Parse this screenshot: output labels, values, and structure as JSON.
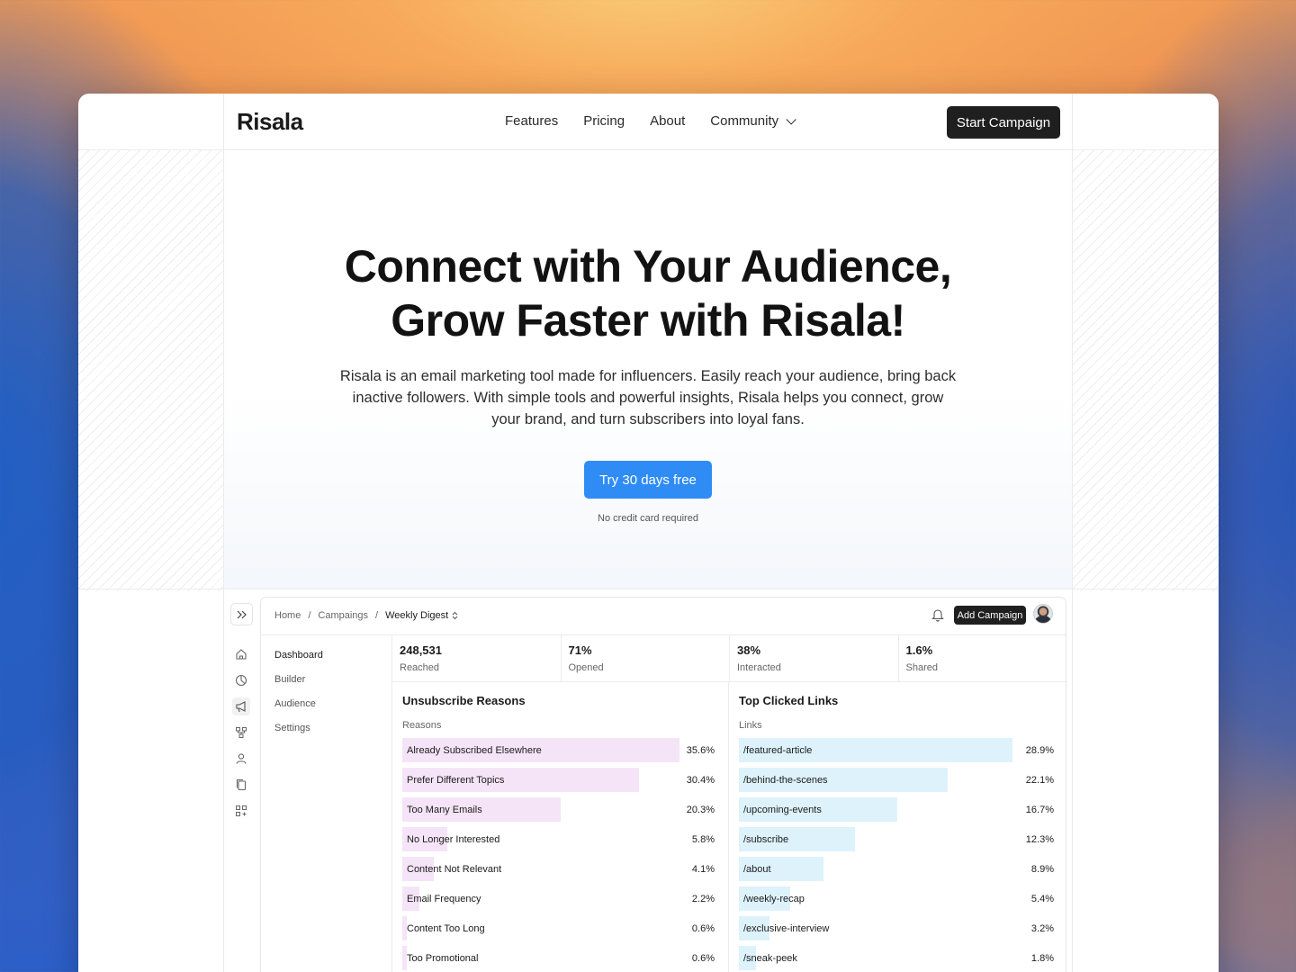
{
  "brand": "Risala",
  "nav": {
    "items": [
      "Features",
      "Pricing",
      "About",
      "Community"
    ],
    "cta": "Start Campaign"
  },
  "hero": {
    "title_line1": "Connect with Your Audience,",
    "title_line2": "Grow Faster with Risala!",
    "subtitle": "Risala is an email marketing tool made for influencers. Easily reach your audience, bring back inactive followers. With simple tools and powerful insights, Risala helps you connect, grow your brand, and turn subscribers into loyal fans.",
    "cta": "Try 30 days free",
    "note": "No credit card required"
  },
  "dashboard": {
    "breadcrumb": [
      "Home",
      "Campaings",
      "Weekly Digest"
    ],
    "add_button": "Add Campaign",
    "sidebar": [
      "Dashboard",
      "Builder",
      "Audience",
      "Settings"
    ],
    "rail_icons": [
      "home-icon",
      "pie-chart-icon",
      "megaphone-icon",
      "workflow-icon",
      "user-icon",
      "copy-icon",
      "apps-icon"
    ],
    "stats": [
      {
        "value": "248,531",
        "label": "Reached"
      },
      {
        "value": "71%",
        "label": "Opened"
      },
      {
        "value": "38%",
        "label": "Interacted"
      },
      {
        "value": "1.6%",
        "label": "Shared"
      }
    ],
    "unsubscribe": {
      "title": "Unsubscribe Reasons",
      "subtitle": "Reasons",
      "color": "#f5e4f7",
      "rows": [
        {
          "label": "Already Subscribed Elsewhere",
          "pct": "35.6%",
          "value": 35.6
        },
        {
          "label": "Prefer Different Topics",
          "pct": "30.4%",
          "value": 30.4
        },
        {
          "label": "Too Many Emails",
          "pct": "20.3%",
          "value": 20.3
        },
        {
          "label": "No Longer Interested",
          "pct": "5.8%",
          "value": 5.8
        },
        {
          "label": "Content Not Relevant",
          "pct": "4.1%",
          "value": 4.1
        },
        {
          "label": "Email Frequency",
          "pct": "2.2%",
          "value": 2.2
        },
        {
          "label": "Content Too Long",
          "pct": "0.6%",
          "value": 0.6
        },
        {
          "label": "Too Promotional",
          "pct": "0.6%",
          "value": 0.6
        }
      ]
    },
    "links": {
      "title": "Top Clicked Links",
      "subtitle": "Links",
      "color": "#ddf2fb",
      "rows": [
        {
          "label": "/featured-article",
          "pct": "28.9%",
          "value": 28.9
        },
        {
          "label": "/behind-the-scenes",
          "pct": "22.1%",
          "value": 22.1
        },
        {
          "label": "/upcoming-events",
          "pct": "16.7%",
          "value": 16.7
        },
        {
          "label": "/subscribe",
          "pct": "12.3%",
          "value": 12.3
        },
        {
          "label": "/about",
          "pct": "8.9%",
          "value": 8.9
        },
        {
          "label": "/weekly-recap",
          "pct": "5.4%",
          "value": 5.4
        },
        {
          "label": "/exclusive-interview",
          "pct": "3.2%",
          "value": 3.2
        },
        {
          "label": "/sneak-peek",
          "pct": "1.8%",
          "value": 1.8
        }
      ]
    }
  }
}
